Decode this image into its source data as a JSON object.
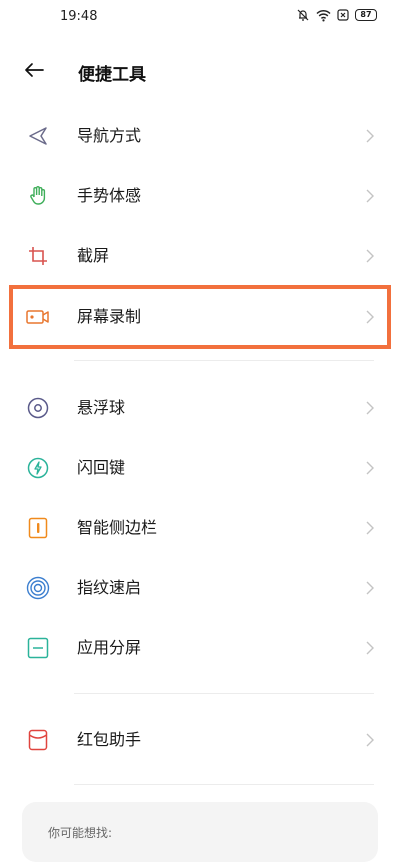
{
  "status_bar": {
    "time": "19:48",
    "battery": "87",
    "icons": [
      "mute-bell-icon",
      "wifi-icon",
      "sim-error-icon",
      "battery-icon"
    ]
  },
  "header": {
    "back_icon": "arrow-left-icon",
    "title": "便捷工具"
  },
  "items": [
    {
      "label": "导航方式",
      "icon": "navigation-icon",
      "color": "#6b6b8a"
    },
    {
      "label": "手势体感",
      "icon": "hand-gesture-icon",
      "color": "#3fae5a"
    },
    {
      "label": "截屏",
      "icon": "crop-icon",
      "color": "#d9534f"
    },
    {
      "label": "屏幕录制",
      "icon": "video-record-icon",
      "color": "#e8762e"
    },
    {
      "label": "悬浮球",
      "icon": "floating-ball-icon",
      "color": "#5a5a8a"
    },
    {
      "label": "闪回键",
      "icon": "lightning-icon",
      "color": "#2bb39a"
    },
    {
      "label": "智能侧边栏",
      "icon": "sidebar-icon",
      "color": "#f08a1c"
    },
    {
      "label": "指纹速启",
      "icon": "fingerprint-icon",
      "color": "#3b7ecf"
    },
    {
      "label": "应用分屏",
      "icon": "split-screen-icon",
      "color": "#2bb39a"
    },
    {
      "label": "红包助手",
      "icon": "red-envelope-icon",
      "color": "#e0443e"
    }
  ],
  "suggestion": {
    "title": "你可能想找:"
  },
  "colors": {
    "highlight": "#f2703d",
    "chevron": "#c4c4c4",
    "divider": "#ececec"
  }
}
